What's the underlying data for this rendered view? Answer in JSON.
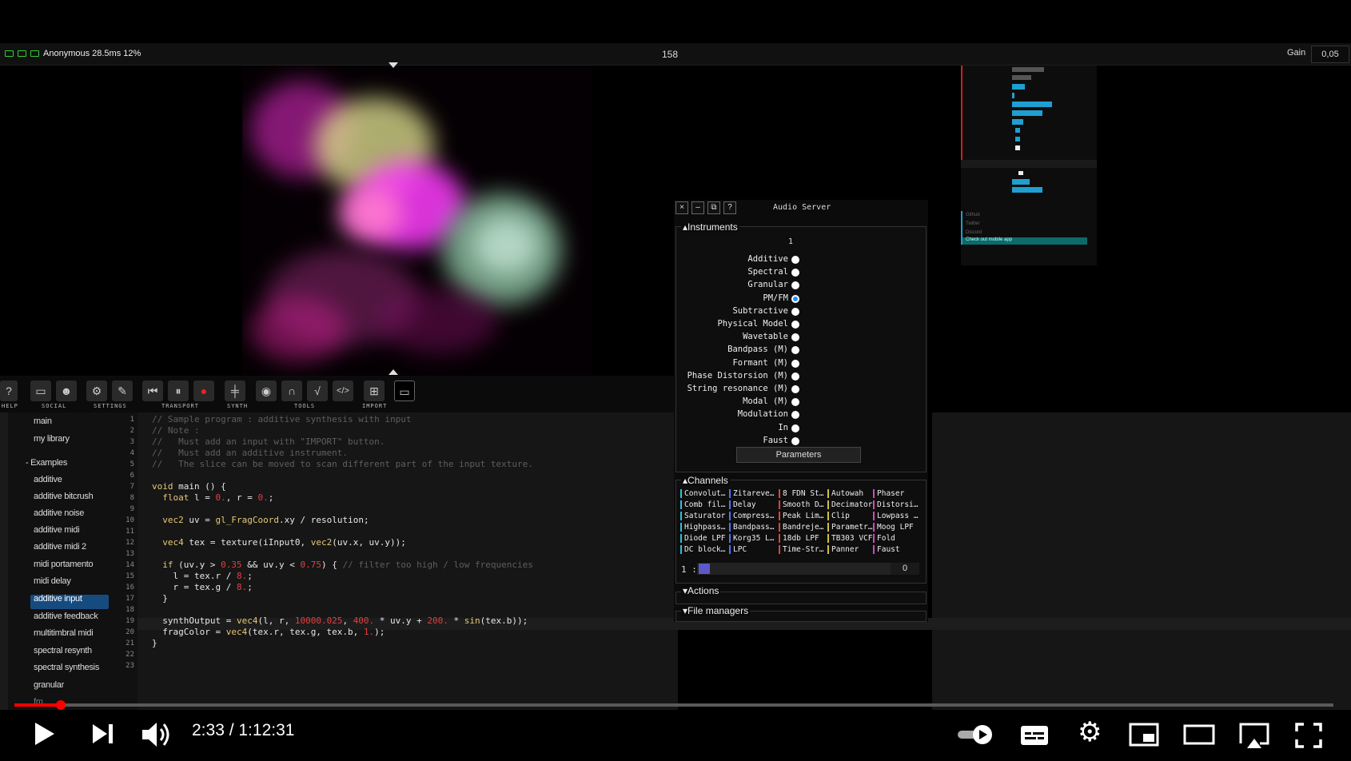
{
  "status": {
    "user_text": "Anonymous 28.5ms 12%",
    "frame": "158",
    "gain_label": "Gain",
    "gain_value": "0,05"
  },
  "toolbar": {
    "labels": [
      "HELP",
      "SOCIAL",
      "SETTINGS",
      "TRANSPORT",
      "SYNTH",
      "TOOLS",
      "IMPORT"
    ]
  },
  "sidebar": {
    "items": [
      "main",
      "my library",
      "Examples",
      "additive",
      "additive bitcrush",
      "additive noise",
      "additive midi",
      "additive midi 2",
      "midi portamento",
      "midi delay",
      "additive input",
      "additive feedback",
      "multitimbral midi",
      "spectral resynth",
      "spectral synthesis",
      "granular",
      "fm"
    ],
    "selected": "additive input"
  },
  "editor": {
    "line_numbers": [
      "1",
      "2",
      "3",
      "4",
      "5",
      "6",
      "7",
      "8",
      "9",
      "10",
      "11",
      "12",
      "13",
      "14",
      "15",
      "16",
      "17",
      "18",
      "19",
      "20",
      "21",
      "22",
      "23"
    ]
  },
  "audio_server": {
    "title": "Audio Server",
    "window_buttons": [
      "×",
      "–",
      "⧉",
      "?"
    ],
    "instruments_header": "Instruments",
    "column": "1",
    "instruments": [
      "Additive",
      "Spectral",
      "Granular",
      "PM/FM",
      "Subtractive",
      "Physical Model",
      "Wavetable",
      "Bandpass (M)",
      "Formant (M)",
      "Phase Distorsion (M)",
      "String resonance (M)",
      "Modal (M)",
      "Modulation",
      "In",
      "Faust"
    ],
    "selected_instrument": "PM/FM",
    "parameters_button": "Parameters",
    "channels_header": "Channels",
    "channels": [
      "Convolut…",
      "Zitareve…",
      "8 FDN St…",
      "Autowah",
      "Phaser",
      "Comb fil…",
      "Delay",
      "Decimator",
      "Distorsi…",
      "Saturator",
      "Compress…",
      "Peak Lim…",
      "Clip",
      "Lowpass …",
      "Highpass…",
      "Bandpass…",
      "Bandreje…",
      "Parametr…",
      "Moog LPF",
      "Diode LPF",
      "Korg35 L…",
      "18db LPF",
      "TB303 VCF",
      "Fold",
      "DC block…",
      "LPC",
      "Time-Str…",
      "Panner",
      "Faust"
    ],
    "channel_row_label": "1 :",
    "channel_row_value": "0",
    "actions_header": "Actions",
    "file_managers_header": "File managers"
  },
  "right_panel": {
    "links": [
      "Github",
      "Twitter",
      "Discord",
      "Check out mobile app"
    ]
  },
  "player": {
    "time": "2:33 / 1:12:31",
    "progress": 0.034
  },
  "colors": {
    "accent_red": "#ff0000",
    "selection": "#164b80",
    "slider": "#1f9fd1"
  }
}
